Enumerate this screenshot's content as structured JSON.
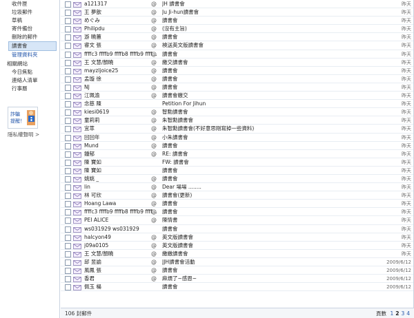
{
  "sidebar": {
    "folders": [
      "收件匣",
      "垃圾郵件",
      "草稿",
      "寄件備份",
      "刪除的郵件"
    ],
    "selected": "讀書會",
    "manage": "管理資料夾",
    "related_heading": "相關網站",
    "related": [
      "今日焦點",
      "連絡人清單",
      "行事曆"
    ],
    "promo": {
      "line1": "詐騙",
      "line2": "提醒！"
    },
    "privacy": "隱私權聲明",
    "privacy_arrow": ">"
  },
  "list": {
    "rows": [
      {
        "sender": "a121317",
        "att": "@",
        "subject": "JH 讀書會",
        "date": "昨天"
      },
      {
        "sender": "王 夢歆",
        "att": "@",
        "subject": "Ju Ji-hun讀書會",
        "date": "昨天"
      },
      {
        "sender": "めぐみ",
        "att": "@",
        "subject": "讀書會",
        "date": "昨天"
      },
      {
        "sender": "Philipdu",
        "att": "@",
        "subject": "(沒有主旨)",
        "date": "昨天"
      },
      {
        "sender": "游 曉蕙",
        "att": "@",
        "subject": "讀書會",
        "date": "昨天"
      },
      {
        "sender": "睿文 張",
        "att": "@",
        "subject": "検送英文版讀書會",
        "date": "昨天"
      },
      {
        "sender": "ffffc3 ffffb9 ffffb8 ffffb9 ffff...",
        "att": "@",
        "subject": "讀書會",
        "date": "昨天"
      },
      {
        "sender": "王 文慧/顏曉",
        "att": "@",
        "subject": "繳交讀書會",
        "date": "昨天"
      },
      {
        "sender": "mayzljoice25",
        "att": "@",
        "subject": "讀書會",
        "date": "昨天"
      },
      {
        "sender": "孟璇 徐",
        "att": "@",
        "subject": "讀書會",
        "date": "昨天"
      },
      {
        "sender": "NJ",
        "att": "@",
        "subject": "讀書會",
        "date": "昨天"
      },
      {
        "sender": "江珮渝",
        "att": "@",
        "subject": "讀書會繳交",
        "date": "昨天"
      },
      {
        "sender": "念慈 陳",
        "att": "",
        "subject": "Petition For Jihun",
        "date": "昨天"
      },
      {
        "sender": "kiesi0619",
        "att": "@",
        "subject": "智勳讀書會",
        "date": "昨天"
      },
      {
        "sender": "童莉莉",
        "att": "@",
        "subject": "朱智勳讀書會",
        "date": "昨天"
      },
      {
        "sender": "宜萃",
        "att": "@",
        "subject": "朱智勳讀書會(不好意思剛寫掉一些資料)",
        "date": "昨天"
      },
      {
        "sender": "回回年",
        "att": "@",
        "subject": "小朱讀書會",
        "date": "昨天"
      },
      {
        "sender": "Mund",
        "att": "@",
        "subject": "讀書會",
        "date": "昨天"
      },
      {
        "sender": "鍾郁",
        "att": "@",
        "subject": "RE: 讀書會",
        "date": "昨天"
      },
      {
        "sender": "陳 寶如",
        "att": "",
        "subject": "FW: 讀書會",
        "date": "昨天"
      },
      {
        "sender": "陳 寶如",
        "att": "",
        "subject": "讀書會",
        "date": "昨天"
      },
      {
        "sender": "姚姚 _",
        "att": "@",
        "subject": "讀書會",
        "date": "昨天"
      },
      {
        "sender": "lin",
        "att": "@",
        "subject": "Dear 場場 ........",
        "date": "昨天"
      },
      {
        "sender": "林 可欣",
        "att": "@",
        "subject": "讀書會(更新)",
        "date": "昨天"
      },
      {
        "sender": "Hoang Lawa",
        "att": "@",
        "subject": "讀書會",
        "date": "昨天"
      },
      {
        "sender": "ffffc3 ffffb9 ffffb8 ffffb9 ffff...",
        "att": "@",
        "subject": "讀書會",
        "date": "昨天"
      },
      {
        "sender": "PEI ALICE",
        "att": "@",
        "subject": "陳情書",
        "date": "昨天"
      },
      {
        "sender": "ws031929 ws031929",
        "att": "",
        "subject": "讀書會",
        "date": "昨天"
      },
      {
        "sender": "halcyon49",
        "att": "@",
        "subject": "英文版讀書會",
        "date": "昨天"
      },
      {
        "sender": "j09a0105",
        "att": "@",
        "subject": "英文版讀書會",
        "date": "昨天"
      },
      {
        "sender": "王 文慧/顏曉",
        "att": "@",
        "subject": "繳繳讀書會",
        "date": "昨天"
      },
      {
        "sender": "邱 昱諭",
        "att": "@",
        "subject": "JJH讀書會活動",
        "date": "2009/6/12"
      },
      {
        "sender": "風鳳 張",
        "att": "@",
        "subject": "讀書會",
        "date": "2009/6/12"
      },
      {
        "sender": "香君",
        "att": "@",
        "subject": "麻煩了~感恩~",
        "date": "2009/6/12"
      },
      {
        "sender": "佩玉 楊",
        "att": "",
        "subject": "讀書會",
        "date": "2009/6/12"
      }
    ]
  },
  "status": {
    "count": "106 封郵件",
    "pages_label": "頁數",
    "pages": [
      "1",
      "2",
      "3",
      "4"
    ],
    "current_page": "2"
  }
}
